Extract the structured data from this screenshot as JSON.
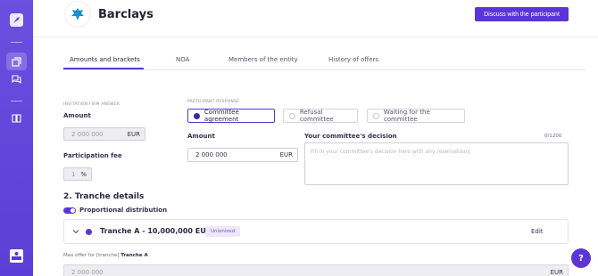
{
  "header": {
    "title": "Barclays",
    "discuss_label": "Discuss with the participant"
  },
  "tabs": [
    {
      "label": "Amounts and brackets",
      "active": true
    },
    {
      "label": "NOA"
    },
    {
      "label": "Members of the entity"
    },
    {
      "label": "History of offers"
    }
  ],
  "invitation": {
    "caption": "INVITATION FIRM ANSWER",
    "amount_label": "Amount",
    "amount_value": "2 000 000",
    "amount_unit": "EUR",
    "fee_label": "Participation fee",
    "fee_value": "1",
    "fee_unit": "%"
  },
  "response": {
    "caption": "PARTICIPANT RESPONSE",
    "options": [
      {
        "label": "Committee agreement",
        "selected": true
      },
      {
        "label": "Refusal committee"
      },
      {
        "label": "Waiting for the committee"
      }
    ],
    "amount_label": "Amount",
    "amount_value": "2 000 000",
    "amount_unit": "EUR",
    "decision_label": "Your committee's decision",
    "decision_counter": "0/1200",
    "decision_placeholder": "Fill in your committee's decision here with any reservations"
  },
  "tranche": {
    "section_title": "2. Tranche details",
    "toggle_label": "Proportional distribution",
    "toggle_on": true,
    "name": "Tranche A - 10,000,000 EUR",
    "badge": "Unionized",
    "edit_label": "Edit",
    "max_offer_prefix": "Max offer for [tranche]",
    "max_offer_name": "Tranche A",
    "max_offer_value": "2 000 000",
    "max_offer_unit": "EUR"
  },
  "help_label": "?",
  "colors": {
    "accent": "#5b35d5",
    "sidebar": "#6b4fe0"
  },
  "icons": [
    "app-logo-icon",
    "offers-icon",
    "chat-icon",
    "book-icon",
    "user-card-icon",
    "barclays-eagle-icon",
    "chevron-down-icon"
  ]
}
